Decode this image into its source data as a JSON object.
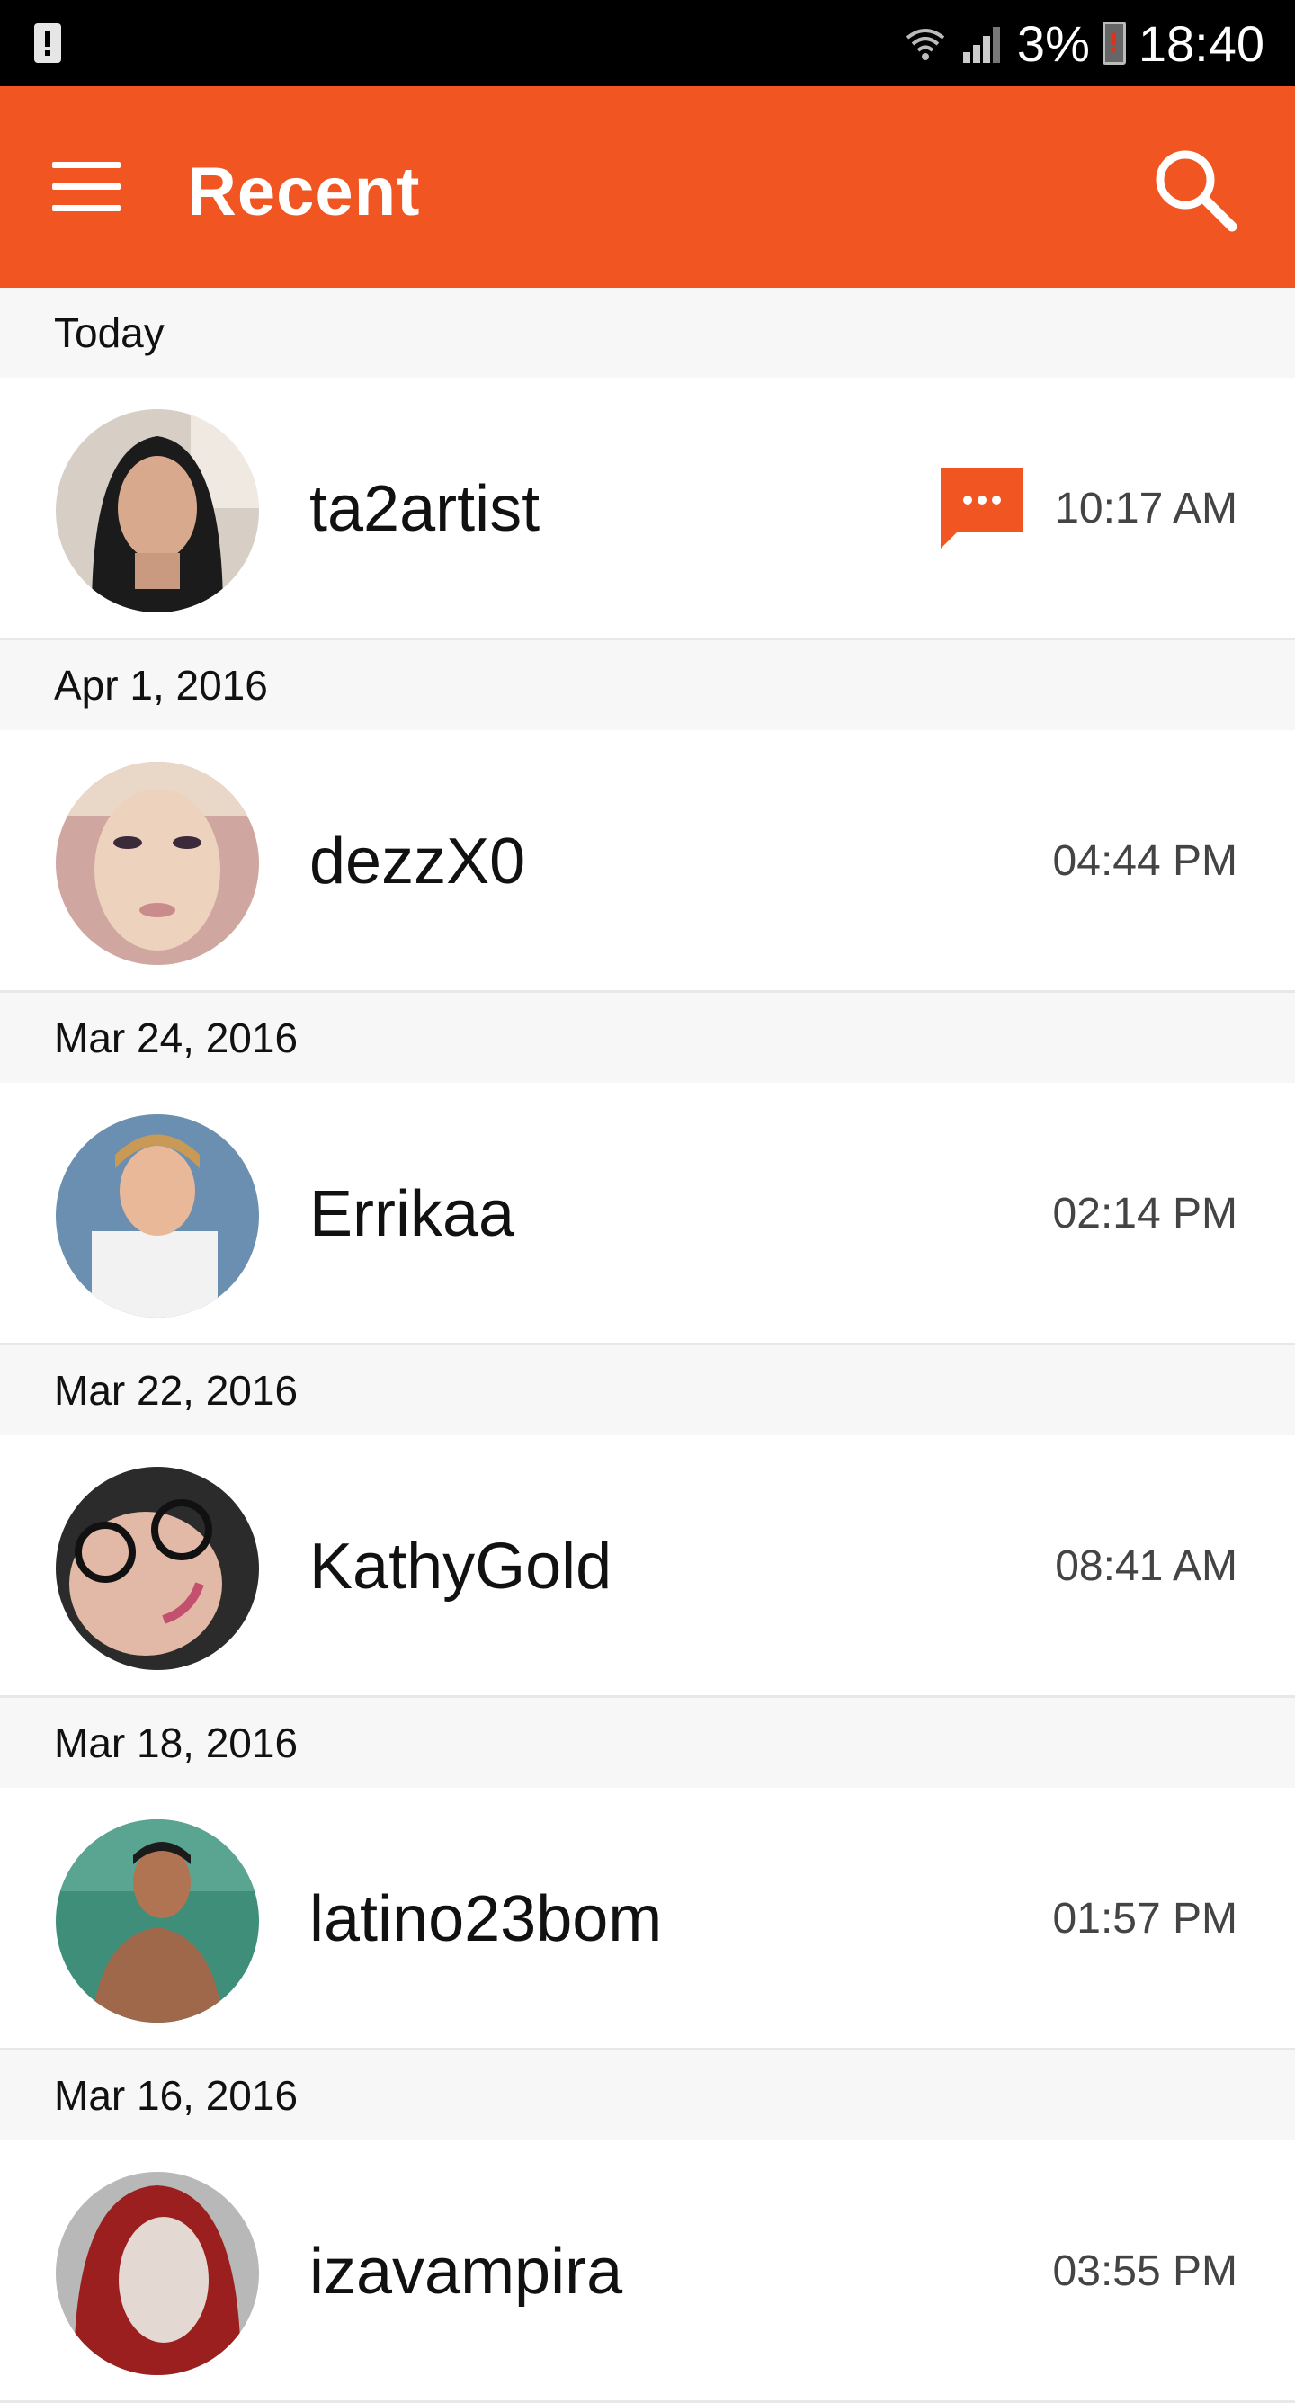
{
  "status_bar": {
    "battery_text": "3%",
    "time": "18:40"
  },
  "app_bar": {
    "title": "Recent",
    "color": "#f05522"
  },
  "sections": [
    {
      "header": "Today",
      "item": {
        "username": "ta2artist",
        "time": "10:17 AM",
        "has_message_icon": true
      }
    },
    {
      "header": "Apr 1, 2016",
      "item": {
        "username": "dezzX0",
        "time": "04:44 PM",
        "has_message_icon": false
      }
    },
    {
      "header": "Mar 24, 2016",
      "item": {
        "username": "Errikaa",
        "time": "02:14 PM",
        "has_message_icon": false
      }
    },
    {
      "header": "Mar 22, 2016",
      "item": {
        "username": "KathyGold",
        "time": "08:41 AM",
        "has_message_icon": false
      }
    },
    {
      "header": "Mar 18, 2016",
      "item": {
        "username": "latino23bom",
        "time": "01:57 PM",
        "has_message_icon": false
      }
    },
    {
      "header": "Mar 16, 2016",
      "item": {
        "username": "izavampira",
        "time": "03:55 PM",
        "has_message_icon": false
      }
    }
  ],
  "icons": {
    "menu": "menu-icon",
    "search": "search-icon",
    "message": "chat-bubble-icon"
  }
}
